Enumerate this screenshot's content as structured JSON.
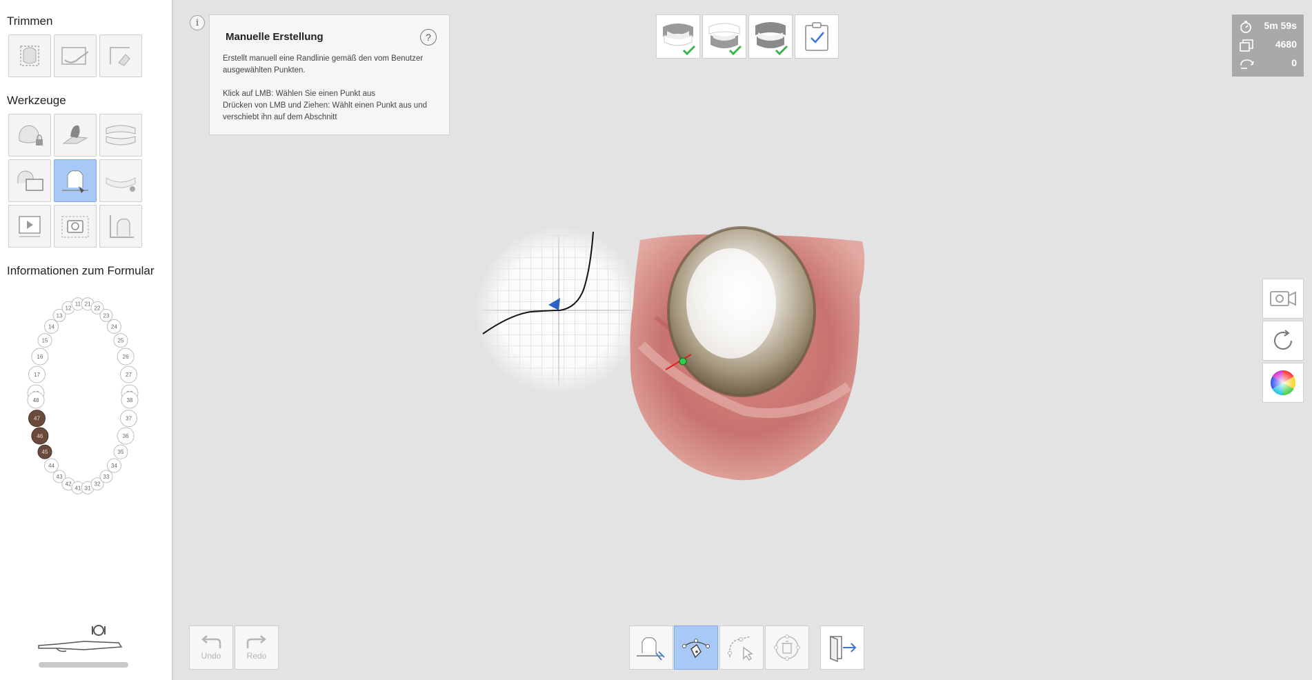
{
  "sidebar": {
    "trim_title": "Trimmen",
    "tools_title": "Werkzeuge",
    "form_title": "Informationen zum Formular",
    "trim_tools": [
      {
        "icon": "trim-box-icon"
      },
      {
        "icon": "trim-brush-icon"
      },
      {
        "icon": "trim-lasso-icon"
      }
    ],
    "tools": [
      {
        "icon": "tooth-lock-icon"
      },
      {
        "icon": "tooth-fill-icon"
      },
      {
        "icon": "occlusion-icon"
      },
      {
        "icon": "scan-compare-icon"
      },
      {
        "icon": "margin-line-icon"
      },
      {
        "icon": "arch-remove-icon"
      },
      {
        "icon": "video-play-icon"
      },
      {
        "icon": "camera-icon"
      },
      {
        "icon": "measure-icon"
      }
    ],
    "teeth_upper": [
      "18",
      "17",
      "16",
      "15",
      "14",
      "13",
      "12",
      "11",
      "21",
      "22",
      "23",
      "24",
      "25",
      "26",
      "27",
      "28"
    ],
    "teeth_lower": [
      "48",
      "47",
      "46",
      "45",
      "44",
      "43",
      "42",
      "41",
      "31",
      "32",
      "33",
      "34",
      "35",
      "36",
      "37",
      "38"
    ],
    "selected_teeth": [
      "47",
      "46",
      "45"
    ]
  },
  "info": {
    "icon": "i",
    "title": "Manuelle Erstellung",
    "help": "?",
    "description": "Erstellt manuell eine Randlinie gemäß den vom Benutzer ausgewählten Punkten.",
    "instruction_1": "Klick auf LMB: Wählen Sie einen Punkt aus",
    "instruction_2": "Drücken von LMB und Ziehen: Wählt einen Punkt aus und verschiebt ihn auf dem Abschnitt"
  },
  "steps": [
    {
      "icon": "upper-jaw-icon",
      "done": true
    },
    {
      "icon": "lower-jaw-icon",
      "done": true
    },
    {
      "icon": "occlusion-jaw-icon",
      "done": true
    },
    {
      "icon": "clipboard-check-icon",
      "done": false
    }
  ],
  "stats": {
    "time": "5m 59s",
    "count": "4680",
    "rotations": "0"
  },
  "bottom": {
    "undo_label": "Undo",
    "redo_label": "Redo"
  },
  "colors": {
    "accent": "#a8c8f6",
    "check_green": "#3cb44b",
    "selected_tooth": "#6b4a3e"
  }
}
